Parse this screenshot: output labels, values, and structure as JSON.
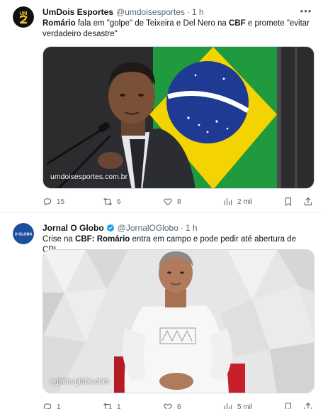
{
  "tweets": [
    {
      "author": {
        "name": "UmDois Esportes",
        "handle": "@umdoisesportes",
        "time": "1 h",
        "avatar_icon": "umdois-logo-icon"
      },
      "text_parts": [
        "Romário",
        " fala em \"golpe\" de Teixeira e Del Nero na ",
        "CBF",
        " e promete \"evitar verdadeiro desastre\""
      ],
      "image": {
        "watermark": "umdoisesportes.com.br",
        "subject": "man speaking at a microphone in front of a Brazilian flag"
      },
      "stats": {
        "replies": "15",
        "reposts": "6",
        "likes": "8",
        "views": "2 mil"
      }
    },
    {
      "author": {
        "name": "Jornal O Globo",
        "handle": "@JornalOGlobo",
        "time": "1 h",
        "avatar_text": "O GLOBO",
        "verified": true
      },
      "text_parts": [
        "Crise na ",
        "CBF: Romário",
        " entra em campo e pode pedir até abertura de CPI"
      ],
      "image": {
        "watermark": "oglobo.globo.com",
        "subject": "man in white shirt seated on a red chair against a white geometric wall"
      },
      "stats": {
        "replies": "1",
        "reposts": "1",
        "likes": "6",
        "views": "5 mil"
      }
    }
  ],
  "colors": {
    "text": "#0f1419",
    "secondary": "#536471",
    "verified": "#1d9bf0",
    "divider": "#eff3f4",
    "oglobo_blue": "#1b4f9c"
  }
}
